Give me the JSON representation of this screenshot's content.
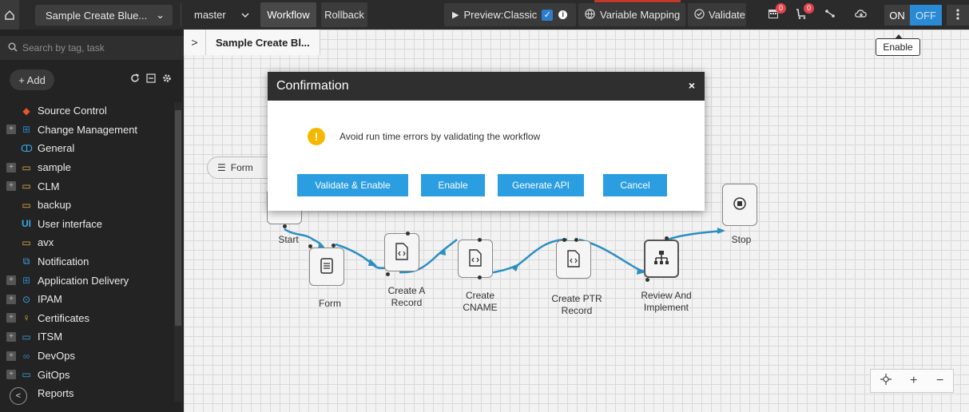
{
  "topbar": {
    "project_name": "Sample Create Blue...",
    "branch": "master",
    "tab_workflow": "Workflow",
    "tab_rollback": "Rollback",
    "preview_label": "Preview:Classic",
    "variable_mapping": "Variable Mapping",
    "validate": "Validate",
    "calendar_badge": "0",
    "cart_badge": "0",
    "on_label": "ON",
    "off_label": "OFF",
    "accent_color": "#2a8ad4"
  },
  "sidebar": {
    "search_placeholder": "Search by tag, task",
    "add_label": "+ Add",
    "items": [
      {
        "label": "Source Control",
        "icon": "git-icon",
        "expandable": false
      },
      {
        "label": "Change Management",
        "icon": "grid-icon",
        "expandable": true
      },
      {
        "label": "General",
        "icon": "circles-icon",
        "expandable": false
      },
      {
        "label": "sample",
        "icon": "folder-icon",
        "expandable": true
      },
      {
        "label": "CLM",
        "icon": "folder-icon",
        "expandable": true
      },
      {
        "label": "backup",
        "icon": "folder-icon",
        "expandable": false
      },
      {
        "label": "User interface",
        "icon": "ui-icon",
        "expandable": false
      },
      {
        "label": "avx",
        "icon": "folder-icon",
        "expandable": false
      },
      {
        "label": "Notification",
        "icon": "notification-icon",
        "expandable": false
      },
      {
        "label": "Application Delivery",
        "icon": "apps-icon",
        "expandable": true
      },
      {
        "label": "IPAM",
        "icon": "ipam-icon",
        "expandable": true
      },
      {
        "label": "Certificates",
        "icon": "certificate-icon",
        "expandable": true
      },
      {
        "label": "ITSM",
        "icon": "folder-icon",
        "expandable": true
      },
      {
        "label": "DevOps",
        "icon": "devops-icon",
        "expandable": true
      },
      {
        "label": "GitOps",
        "icon": "folder-icon",
        "expandable": true
      },
      {
        "label": "Reports",
        "icon": "report-icon",
        "expandable": false
      }
    ]
  },
  "canvas": {
    "breadcrumb_title": "Sample Create Bl...",
    "form_chip": "Form",
    "nodes": {
      "start": "Start",
      "form": "Form",
      "create_a": "Create A Record",
      "create_cname": "Create CNAME",
      "create_ptr": "Create PTR Record",
      "review": "Review And Implement",
      "stop": "Stop"
    },
    "link_color": "#2b8fc1"
  },
  "tooltip": "Enable",
  "modal": {
    "title": "Confirmation",
    "message": "Avoid run time errors by validating the workflow",
    "buttons": [
      "Validate & Enable",
      "Enable",
      "Generate API",
      "Cancel"
    ]
  }
}
